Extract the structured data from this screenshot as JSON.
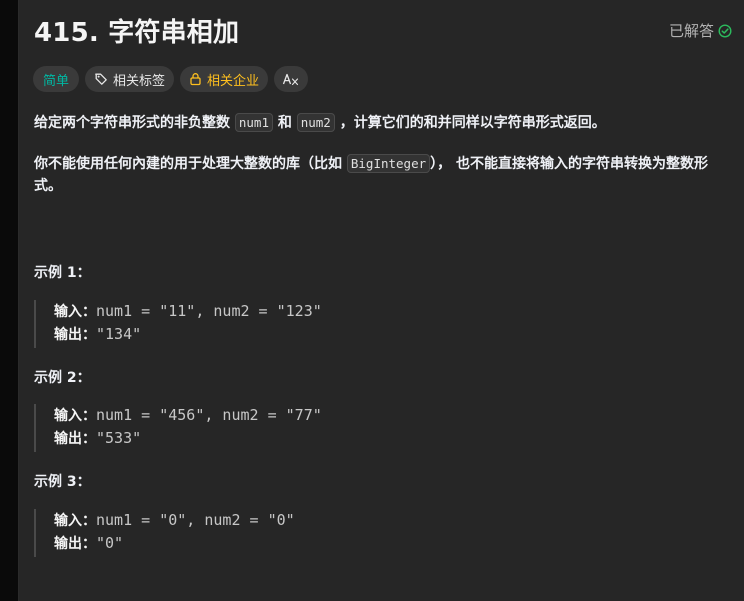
{
  "problem": {
    "title": "415. 字符串相加",
    "status": "已解答"
  },
  "tags": {
    "difficulty": "简单",
    "related_topics": "相关标签",
    "related_companies": "相关企业"
  },
  "description": {
    "p1_a": "给定两个字符串形式的非负整数 ",
    "p1_code1": "num1",
    "p1_b": " 和 ",
    "p1_code2": "num2",
    "p1_c": " ，计算它们的和并同样以字符串形式返回。",
    "p2_a": "你不能使用任何內建的用于处理大整数的库（比如 ",
    "p2_code": "BigInteger",
    "p2_b": "）， 也不能直接将输入的字符串转换为整数形式。"
  },
  "examples": [
    {
      "title": "示例 1：",
      "input_label": "输入：",
      "input": "num1 = \"11\", num2 = \"123\"",
      "output_label": "输出：",
      "output": "\"134\""
    },
    {
      "title": "示例 2：",
      "input_label": "输入：",
      "input": "num1 = \"456\", num2 = \"77\"",
      "output_label": "输出：",
      "output": "\"533\""
    },
    {
      "title": "示例 3：",
      "input_label": "输入：",
      "input": "num1 = \"0\", num2 = \"0\"",
      "output_label": "输出：",
      "output": "\"0\""
    }
  ],
  "colors": {
    "easy": "#00b8a3",
    "company": "#ffc01e",
    "solved_check": "#2cbb5d"
  },
  "icons": {
    "tag": "tag-icon",
    "lock": "lock-icon",
    "translate": "translate-icon",
    "check": "check-circle-icon"
  }
}
